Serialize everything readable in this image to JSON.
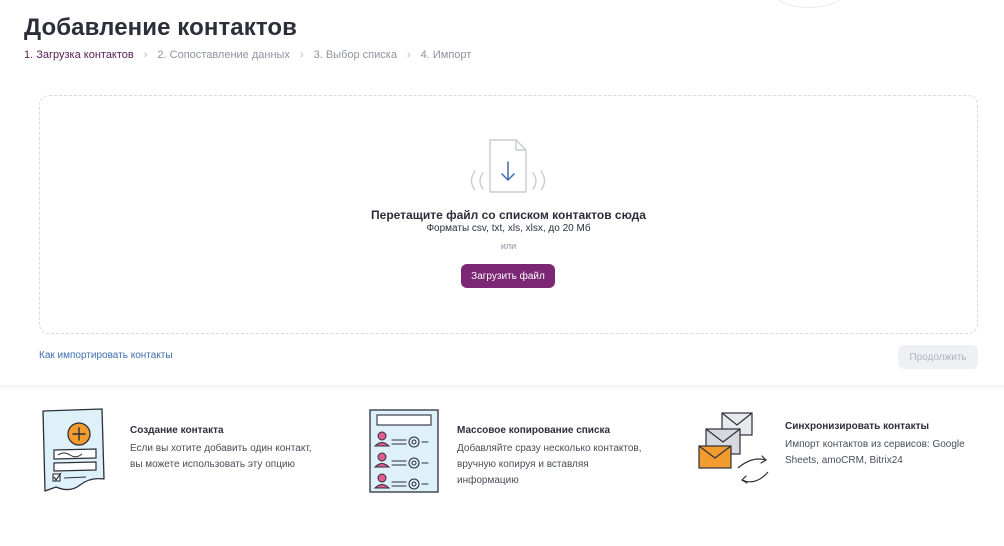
{
  "header": {
    "title": "Добавление контактов",
    "steps": [
      {
        "label": "1. Загрузка контактов",
        "active": true
      },
      {
        "label": "2. Сопоставление данных",
        "active": false
      },
      {
        "label": "3. Выбор списка",
        "active": false
      },
      {
        "label": "4. Импорт",
        "active": false
      }
    ],
    "step_separator": "›"
  },
  "dropzone": {
    "title": "Перетащите файл со списком контактов сюда",
    "formats": "Форматы csv, txt, xls, xlsx, до 20 Мб",
    "or": "или",
    "upload_label": "Загрузить файл"
  },
  "footer": {
    "howto_link": "Как импортировать контакты",
    "continue_label": "Продолжить"
  },
  "cards": [
    {
      "title": "Создание контакта",
      "desc_lines": [
        "Если вы хотите добавить один контакт,",
        "вы можете использовать эту опцию"
      ],
      "icon": "contact-form-icon"
    },
    {
      "title": "Массовое копирование списка",
      "desc_lines": [
        "Добавляйте сразу несколько контактов,",
        "вручную копируя и вставляя",
        "информацию"
      ],
      "icon": "contact-list-icon"
    },
    {
      "title": "Синхронизировать контакты",
      "desc_lines": [
        "Импорт контактов из сервисов: Google",
        "Sheets, amoCRM, Bitrix24"
      ],
      "icon": "sync-envelopes-icon"
    }
  ],
  "colors": {
    "accent": "#7b2774",
    "active_step": "#5b2056",
    "link": "#3d6fb0",
    "illustration_orange": "#f29b2f",
    "illustration_blue": "#dff1f8"
  }
}
